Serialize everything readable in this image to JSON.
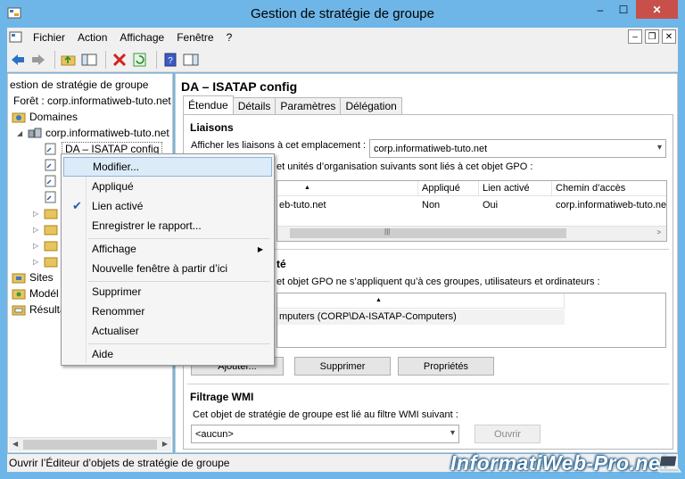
{
  "window": {
    "title": "Gestion de stratégie de groupe",
    "min": "–",
    "max": "☐",
    "close": "✕"
  },
  "menu": {
    "items": [
      "Fichier",
      "Action",
      "Affichage",
      "Fenêtre",
      "?"
    ],
    "mdi_min": "–",
    "mdi_restore": "❐",
    "mdi_close": "✕"
  },
  "tree": {
    "root": "estion de stratégie de groupe",
    "forest": "Forêt : corp.informatiweb-tuto.net",
    "domains": "Domaines",
    "domain": "corp.informatiweb-tuto.net",
    "gpo": "DA – ISATAP config",
    "sites": "Sites",
    "modeling": "Modél",
    "results": "Résulta"
  },
  "gpo": {
    "title": "DA – ISATAP config",
    "tabs": [
      "Étendue",
      "Détails",
      "Paramètres",
      "Délégation"
    ],
    "links": {
      "heading": "Liaisons",
      "location_label": "Afficher les liaisons à cet emplacement :",
      "location_value": "corp.informatiweb-tuto.net",
      "description": "et unités d’organisation suivants sont liés à cet objet GPO :",
      "columns": [
        "",
        "Appliqué",
        "Lien activé",
        "Chemin d’accès"
      ],
      "row": {
        "location": "eb-tuto.net",
        "enforced": "Non",
        "enabled": "Oui",
        "path": "corp.informatiweb-tuto.net"
      }
    },
    "filter": {
      "heading": "té",
      "description": "et objet GPO ne s’appliquent qu’à ces groupes, utilisateurs et ordinateurs :",
      "row": "mputers (CORP\\DA-ISATAP-Computers)",
      "add_button": "Ajouter...",
      "remove_button": "Supprimer",
      "properties_button": "Propriétés"
    },
    "wmi": {
      "heading": "Filtrage WMI",
      "description": "Cet objet de stratégie de groupe est lié au filtre WMI suivant :",
      "value": "<aucun>",
      "open_button": "Ouvrir"
    }
  },
  "context_menu": {
    "edit": "Modifier...",
    "enforced": "Appliqué",
    "link_enabled": "Lien activé",
    "save_report": "Enregistrer le rapport...",
    "view": "Affichage",
    "new_window": "Nouvelle fenêtre à partir d’ici",
    "delete": "Supprimer",
    "rename": "Renommer",
    "refresh": "Actualiser",
    "help": "Aide"
  },
  "status": {
    "text": "Ouvrir l’Éditeur d’objets de stratégie de groupe"
  },
  "watermark": {
    "text": "InformatiWeb-Pro.net"
  },
  "colors": {
    "titlebar": "#6fb6e8",
    "close": "#c7504b",
    "highlight": "#dcebf8",
    "check": "#1c5cb6"
  }
}
